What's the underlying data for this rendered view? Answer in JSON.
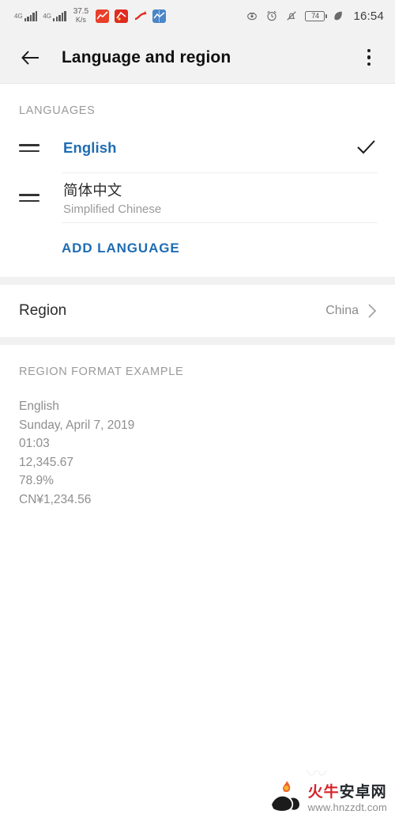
{
  "statusbar": {
    "network_left_label": "4G",
    "network_right_label": "4G",
    "speed_value": "37.5",
    "speed_unit": "K/s",
    "notification_icons": [
      "stock-app-icon",
      "alert-app-icon",
      "arrow-app-icon",
      "chart-app-icon"
    ],
    "right_icons": [
      "eye-icon",
      "alarm-icon",
      "bell-muted-icon",
      "battery-icon",
      "leaf-icon"
    ],
    "battery_level": "74",
    "time": "16:54"
  },
  "appbar": {
    "back_icon": "arrow-left-icon",
    "title": "Language and region",
    "overflow_icon": "more-vertical-icon"
  },
  "languages_section": {
    "header": "LANGUAGES",
    "items": [
      {
        "primary": "English",
        "secondary": "",
        "selected": true,
        "handle_icon": "drag-handle-icon",
        "check_icon": "check-icon"
      },
      {
        "primary": "简体中文",
        "secondary": "Simplified Chinese",
        "selected": false,
        "handle_icon": "drag-handle-icon",
        "check_icon": ""
      }
    ],
    "add_language_label": "ADD LANGUAGE"
  },
  "region_section": {
    "label": "Region",
    "value": "China",
    "chevron_icon": "chevron-right-icon"
  },
  "format_section": {
    "header": "REGION FORMAT EXAMPLE",
    "lines": [
      "English",
      "Sunday, April 7, 2019",
      "01:03",
      "12,345.67",
      "78.9%",
      "CN¥1,234.56"
    ]
  },
  "watermark": {
    "logo_icon": "bull-flame-logo-icon",
    "name_red": "火牛",
    "name_black": "安卓网",
    "url": "www.hnzzdt.com"
  },
  "colors": {
    "accent_blue": "#1f6cb3",
    "chrome_gray": "#f2f2f2",
    "section_gap": "#f1f1f1",
    "muted_text": "#9a9a9a",
    "primary_text": "#2d2d2d",
    "watermark_red": "#d8232a"
  }
}
